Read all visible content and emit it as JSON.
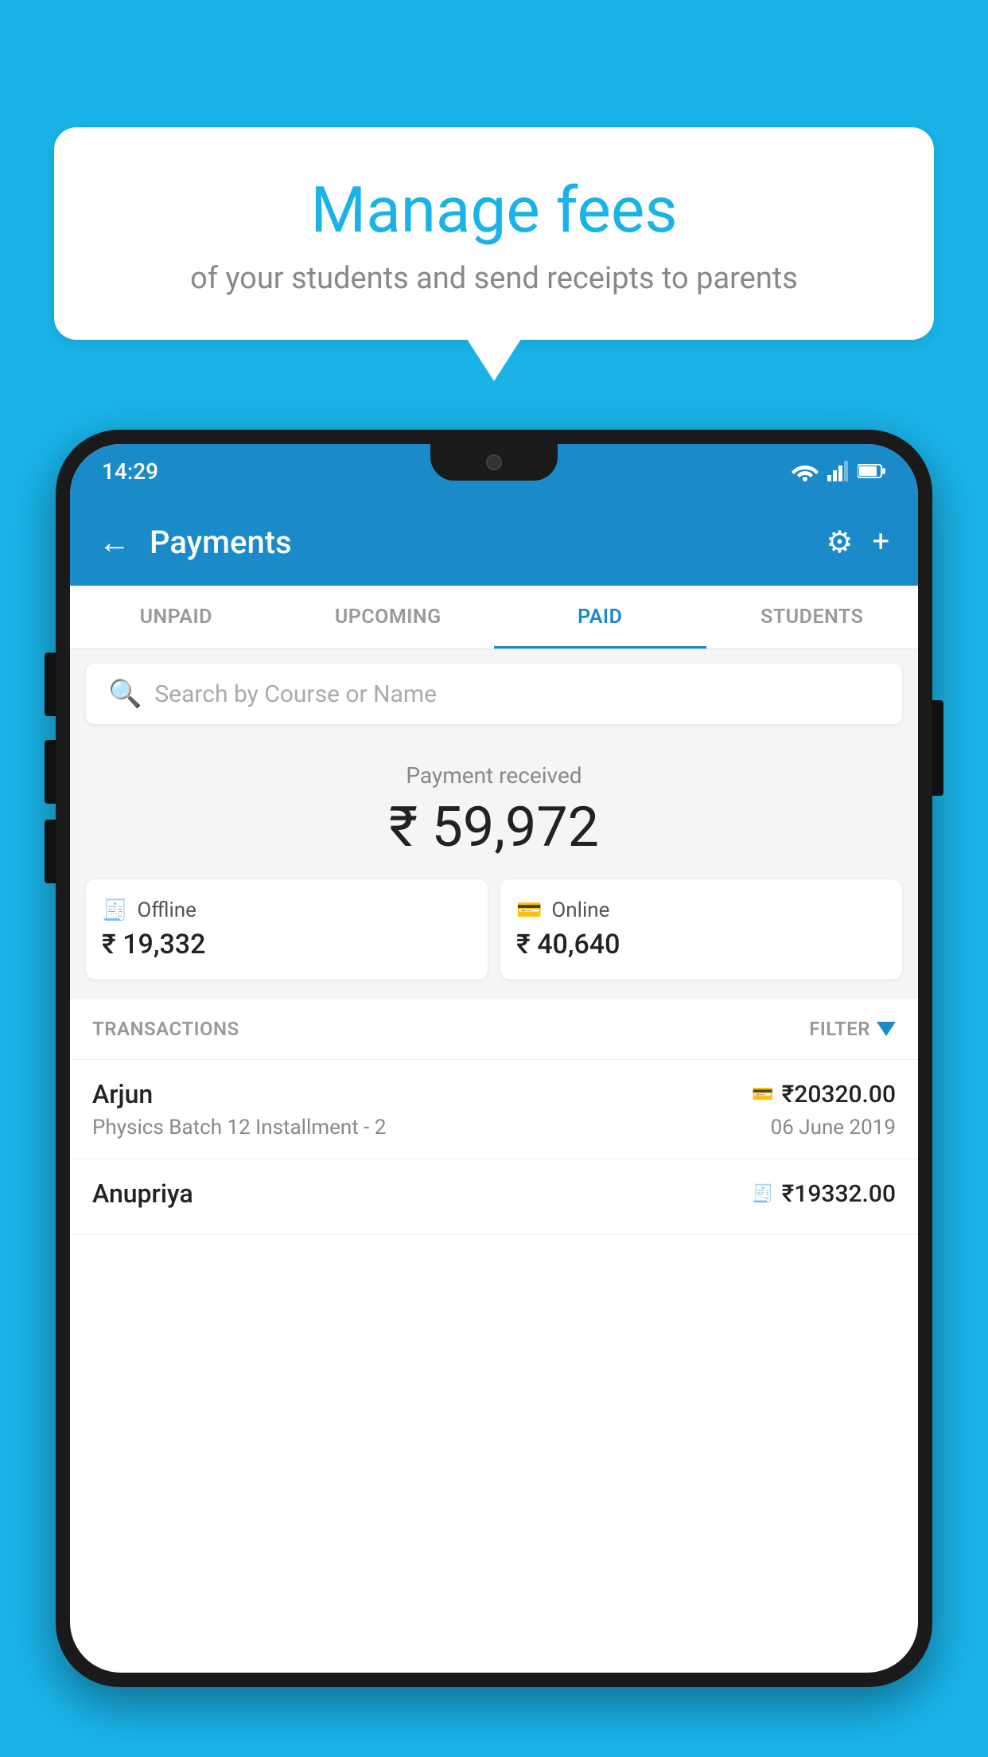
{
  "background_color": "#1ab3e8",
  "bubble": {
    "title": "Manage fees",
    "subtitle": "of your students and send receipts to parents"
  },
  "status_bar": {
    "time": "14:29"
  },
  "app_bar": {
    "title": "Payments",
    "back_label": "←",
    "gear_label": "⚙",
    "plus_label": "+"
  },
  "tabs": [
    {
      "label": "UNPAID",
      "active": false
    },
    {
      "label": "UPCOMING",
      "active": false
    },
    {
      "label": "PAID",
      "active": true
    },
    {
      "label": "STUDENTS",
      "active": false
    }
  ],
  "search": {
    "placeholder": "Search by Course or Name"
  },
  "payment_received": {
    "label": "Payment received",
    "amount": "₹ 59,972"
  },
  "payment_cards": [
    {
      "type": "Offline",
      "amount": "₹ 19,332",
      "icon": "offline"
    },
    {
      "type": "Online",
      "amount": "₹ 40,640",
      "icon": "online"
    }
  ],
  "transactions_section": {
    "label": "TRANSACTIONS",
    "filter_label": "FILTER"
  },
  "transactions": [
    {
      "name": "Arjun",
      "course": "Physics Batch 12 Installment - 2",
      "amount": "₹20320.00",
      "date": "06 June 2019",
      "payment_type": "online"
    },
    {
      "name": "Anupriya",
      "course": "",
      "amount": "₹19332.00",
      "date": "",
      "payment_type": "offline"
    }
  ]
}
